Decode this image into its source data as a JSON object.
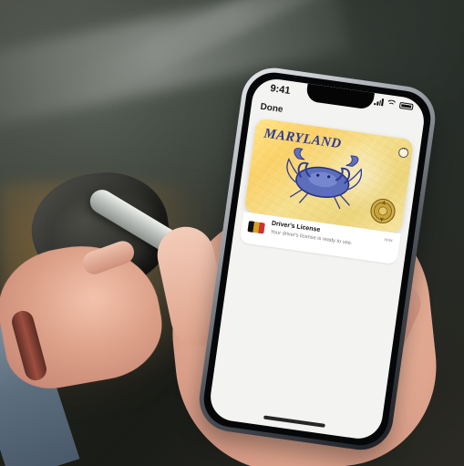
{
  "status_bar": {
    "time": "9:41"
  },
  "wallet": {
    "done_label": "Done",
    "card": {
      "state_name": "MARYLAND"
    },
    "notification": {
      "title": "Driver's License",
      "subtitle": "Your driver's license is ready to use.",
      "time": "now"
    }
  },
  "icons": {
    "menu": "more-options-icon",
    "crab": "crab-icon",
    "seal": "seal-icon",
    "license_badge": "license-badge-icon"
  },
  "colors": {
    "card_yellow": "#fbd168",
    "maryland_blue": "#2f3a93",
    "screen_bg": "#f3f3f1"
  }
}
